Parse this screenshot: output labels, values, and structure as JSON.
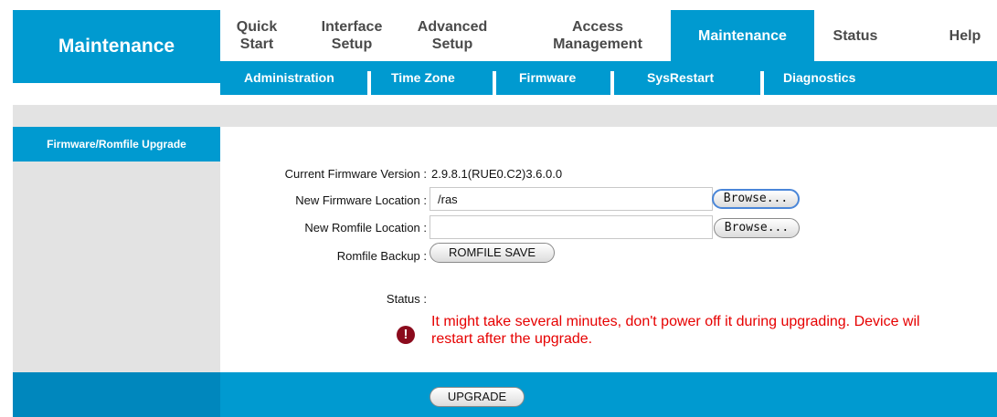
{
  "brand": {
    "title": "Maintenance"
  },
  "top_nav": {
    "tabs": [
      {
        "line1": "Quick",
        "line2": "Start"
      },
      {
        "line1": "Interface",
        "line2": "Setup"
      },
      {
        "line1": "Advanced",
        "line2": "Setup"
      },
      {
        "line1": "Access",
        "line2": "Management"
      },
      {
        "line1": "Maintenance",
        "line2": ""
      },
      {
        "line1": "Status",
        "line2": ""
      },
      {
        "line1": "Help",
        "line2": ""
      }
    ],
    "active_index": 4
  },
  "sub_nav": {
    "items": [
      "Administration",
      "Time Zone",
      "Firmware",
      "SysRestart",
      "Diagnostics"
    ]
  },
  "sidebar": {
    "items": [
      {
        "label": "Firmware/Romfile Upgrade"
      }
    ]
  },
  "form": {
    "current_fw_label": "Current Firmware Version :",
    "current_fw_value": "2.9.8.1(RUE0.C2)3.6.0.0",
    "new_fw_label": "New Firmware Location :",
    "new_fw_value": "/ras",
    "new_romfile_label": "New Romfile Location :",
    "new_romfile_value": "",
    "browse_label": "Browse...",
    "romfile_backup_label": "Romfile Backup :",
    "romfile_save_label": "ROMFILE SAVE",
    "status_label": "Status :",
    "warning_line1": "It might take several minutes, don't power off it during upgrading. Device wil",
    "warning_line2": "restart after the upgrade.",
    "warning_icon": "exclamation-icon"
  },
  "footer": {
    "upgrade_label": "UPGRADE"
  },
  "colors": {
    "accent": "#009ad0",
    "warning": "#e60000",
    "panel": "#e3e3e3"
  }
}
